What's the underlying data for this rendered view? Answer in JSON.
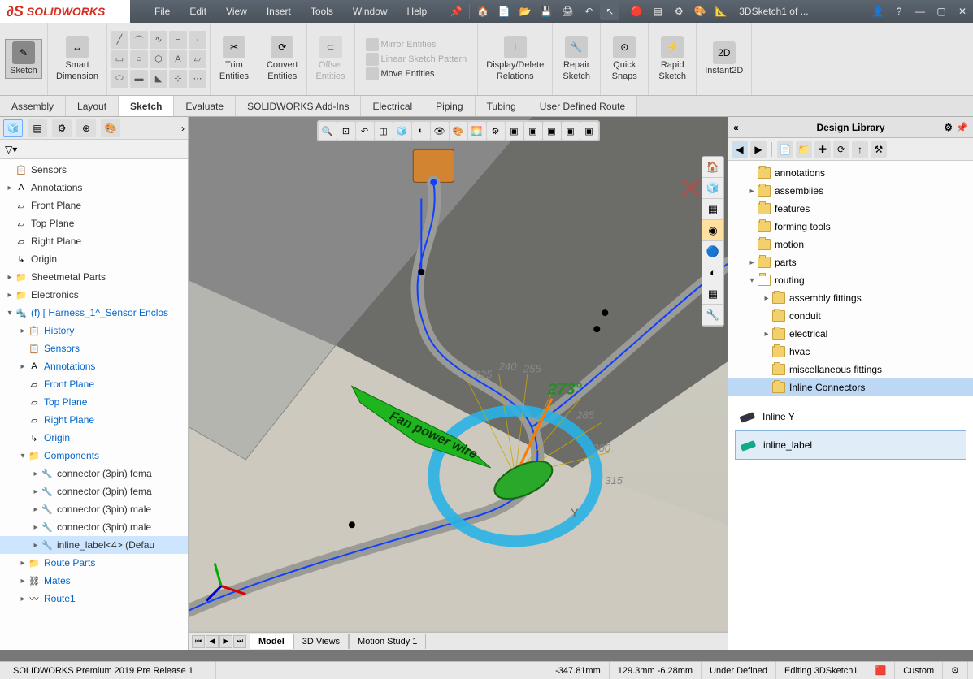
{
  "app": {
    "logo_text": "SOLIDWORKS",
    "doc_name": "3DSketch1 of ..."
  },
  "menu": [
    "File",
    "Edit",
    "View",
    "Insert",
    "Tools",
    "Window",
    "Help"
  ],
  "ribbon": {
    "sketch": "Sketch",
    "smart_dimension": "Smart\nDimension",
    "trim": "Trim\nEntities",
    "convert": "Convert\nEntities",
    "offset": "Offset\nEntities",
    "mirror": "Mirror Entities",
    "linear_pattern": "Linear Sketch Pattern",
    "move": "Move Entities",
    "display_delete": "Display/Delete\nRelations",
    "repair": "Repair\nSketch",
    "quick_snaps": "Quick\nSnaps",
    "rapid": "Rapid\nSketch",
    "instant2d": "Instant2D"
  },
  "cmd_tabs": [
    "Assembly",
    "Layout",
    "Sketch",
    "Evaluate",
    "SOLIDWORKS Add-Ins",
    "Electrical",
    "Piping",
    "Tubing",
    "User Defined Route"
  ],
  "cmd_tab_active": "Sketch",
  "feature_tree": [
    {
      "lvl": 0,
      "exp": "",
      "ico": "📋",
      "lbl": "Sensors",
      "blue": false
    },
    {
      "lvl": 0,
      "exp": "▸",
      "ico": "A",
      "lbl": "Annotations",
      "blue": false
    },
    {
      "lvl": 0,
      "exp": "",
      "ico": "▱",
      "lbl": "Front Plane",
      "blue": false
    },
    {
      "lvl": 0,
      "exp": "",
      "ico": "▱",
      "lbl": "Top Plane",
      "blue": false
    },
    {
      "lvl": 0,
      "exp": "",
      "ico": "▱",
      "lbl": "Right Plane",
      "blue": false
    },
    {
      "lvl": 0,
      "exp": "",
      "ico": "↳",
      "lbl": "Origin",
      "blue": false
    },
    {
      "lvl": 0,
      "exp": "▸",
      "ico": "📁",
      "lbl": "Sheetmetal Parts",
      "blue": false
    },
    {
      "lvl": 0,
      "exp": "▸",
      "ico": "📁",
      "lbl": "Electronics",
      "blue": false
    },
    {
      "lvl": 0,
      "exp": "▾",
      "ico": "🔩",
      "lbl": "(f) [ Harness_1^_Sensor Enclos",
      "blue": true
    },
    {
      "lvl": 1,
      "exp": "▸",
      "ico": "📋",
      "lbl": "History",
      "blue": true
    },
    {
      "lvl": 1,
      "exp": "",
      "ico": "📋",
      "lbl": "Sensors",
      "blue": true
    },
    {
      "lvl": 1,
      "exp": "▸",
      "ico": "A",
      "lbl": "Annotations",
      "blue": true
    },
    {
      "lvl": 1,
      "exp": "",
      "ico": "▱",
      "lbl": "Front Plane",
      "blue": true
    },
    {
      "lvl": 1,
      "exp": "",
      "ico": "▱",
      "lbl": "Top Plane",
      "blue": true
    },
    {
      "lvl": 1,
      "exp": "",
      "ico": "▱",
      "lbl": "Right Plane",
      "blue": true
    },
    {
      "lvl": 1,
      "exp": "",
      "ico": "↳",
      "lbl": "Origin",
      "blue": true
    },
    {
      "lvl": 1,
      "exp": "▾",
      "ico": "📁",
      "lbl": "Components",
      "blue": true
    },
    {
      "lvl": 2,
      "exp": "▸",
      "ico": "🔧",
      "lbl": "connector (3pin) fema",
      "blue": false
    },
    {
      "lvl": 2,
      "exp": "▸",
      "ico": "🔧",
      "lbl": "connector (3pin) fema",
      "blue": false
    },
    {
      "lvl": 2,
      "exp": "▸",
      "ico": "🔧",
      "lbl": "connector (3pin) male",
      "blue": false
    },
    {
      "lvl": 2,
      "exp": "▸",
      "ico": "🔧",
      "lbl": "connector (3pin) male",
      "blue": false
    },
    {
      "lvl": 2,
      "exp": "▸",
      "ico": "🔧",
      "lbl": "inline_label<4> (Defau",
      "blue": false,
      "sel": true
    },
    {
      "lvl": 1,
      "exp": "▸",
      "ico": "📁",
      "lbl": "Route Parts",
      "blue": true
    },
    {
      "lvl": 1,
      "exp": "▸",
      "ico": "⛓",
      "lbl": "Mates",
      "blue": true
    },
    {
      "lvl": 1,
      "exp": "▸",
      "ico": "〰",
      "lbl": "Route1",
      "blue": true
    }
  ],
  "viewport_tabs_bottom": [
    "Model",
    "3D Views",
    "Motion Study 1"
  ],
  "viewport_tab_active": "Model",
  "design_library": {
    "title": "Design Library",
    "tree": [
      {
        "lvl": 0,
        "exp": "",
        "lbl": "annotations"
      },
      {
        "lvl": 0,
        "exp": "▸",
        "lbl": "assemblies"
      },
      {
        "lvl": 0,
        "exp": "",
        "lbl": "features"
      },
      {
        "lvl": 0,
        "exp": "",
        "lbl": "forming tools"
      },
      {
        "lvl": 0,
        "exp": "",
        "lbl": "motion"
      },
      {
        "lvl": 0,
        "exp": "▸",
        "lbl": "parts"
      },
      {
        "lvl": 0,
        "exp": "▾",
        "lbl": "routing",
        "open": true
      },
      {
        "lvl": 1,
        "exp": "▸",
        "lbl": "assembly fittings"
      },
      {
        "lvl": 1,
        "exp": "",
        "lbl": "conduit"
      },
      {
        "lvl": 1,
        "exp": "▸",
        "lbl": "electrical"
      },
      {
        "lvl": 1,
        "exp": "",
        "lbl": "hvac"
      },
      {
        "lvl": 1,
        "exp": "",
        "lbl": "miscellaneous fittings"
      },
      {
        "lvl": 1,
        "exp": "",
        "lbl": "Inline Connectors",
        "sel": true
      }
    ],
    "preview": [
      {
        "name": "Inline Y",
        "color": "#334"
      },
      {
        "name": "inline_label",
        "color": "#1a8",
        "sel": true
      }
    ]
  },
  "angles": {
    "current": "273°",
    "ticks": [
      "225",
      "240",
      "255",
      "285",
      "300",
      "315"
    ]
  },
  "wire_label": "Fan power wire",
  "status": {
    "version": "SOLIDWORKS Premium 2019 Pre Release 1",
    "coord_x": "-347.81mm",
    "coord_yz": "129.3mm  -6.28mm",
    "state": "Under Defined",
    "editing": "Editing 3DSketch1",
    "units": "Custom"
  }
}
